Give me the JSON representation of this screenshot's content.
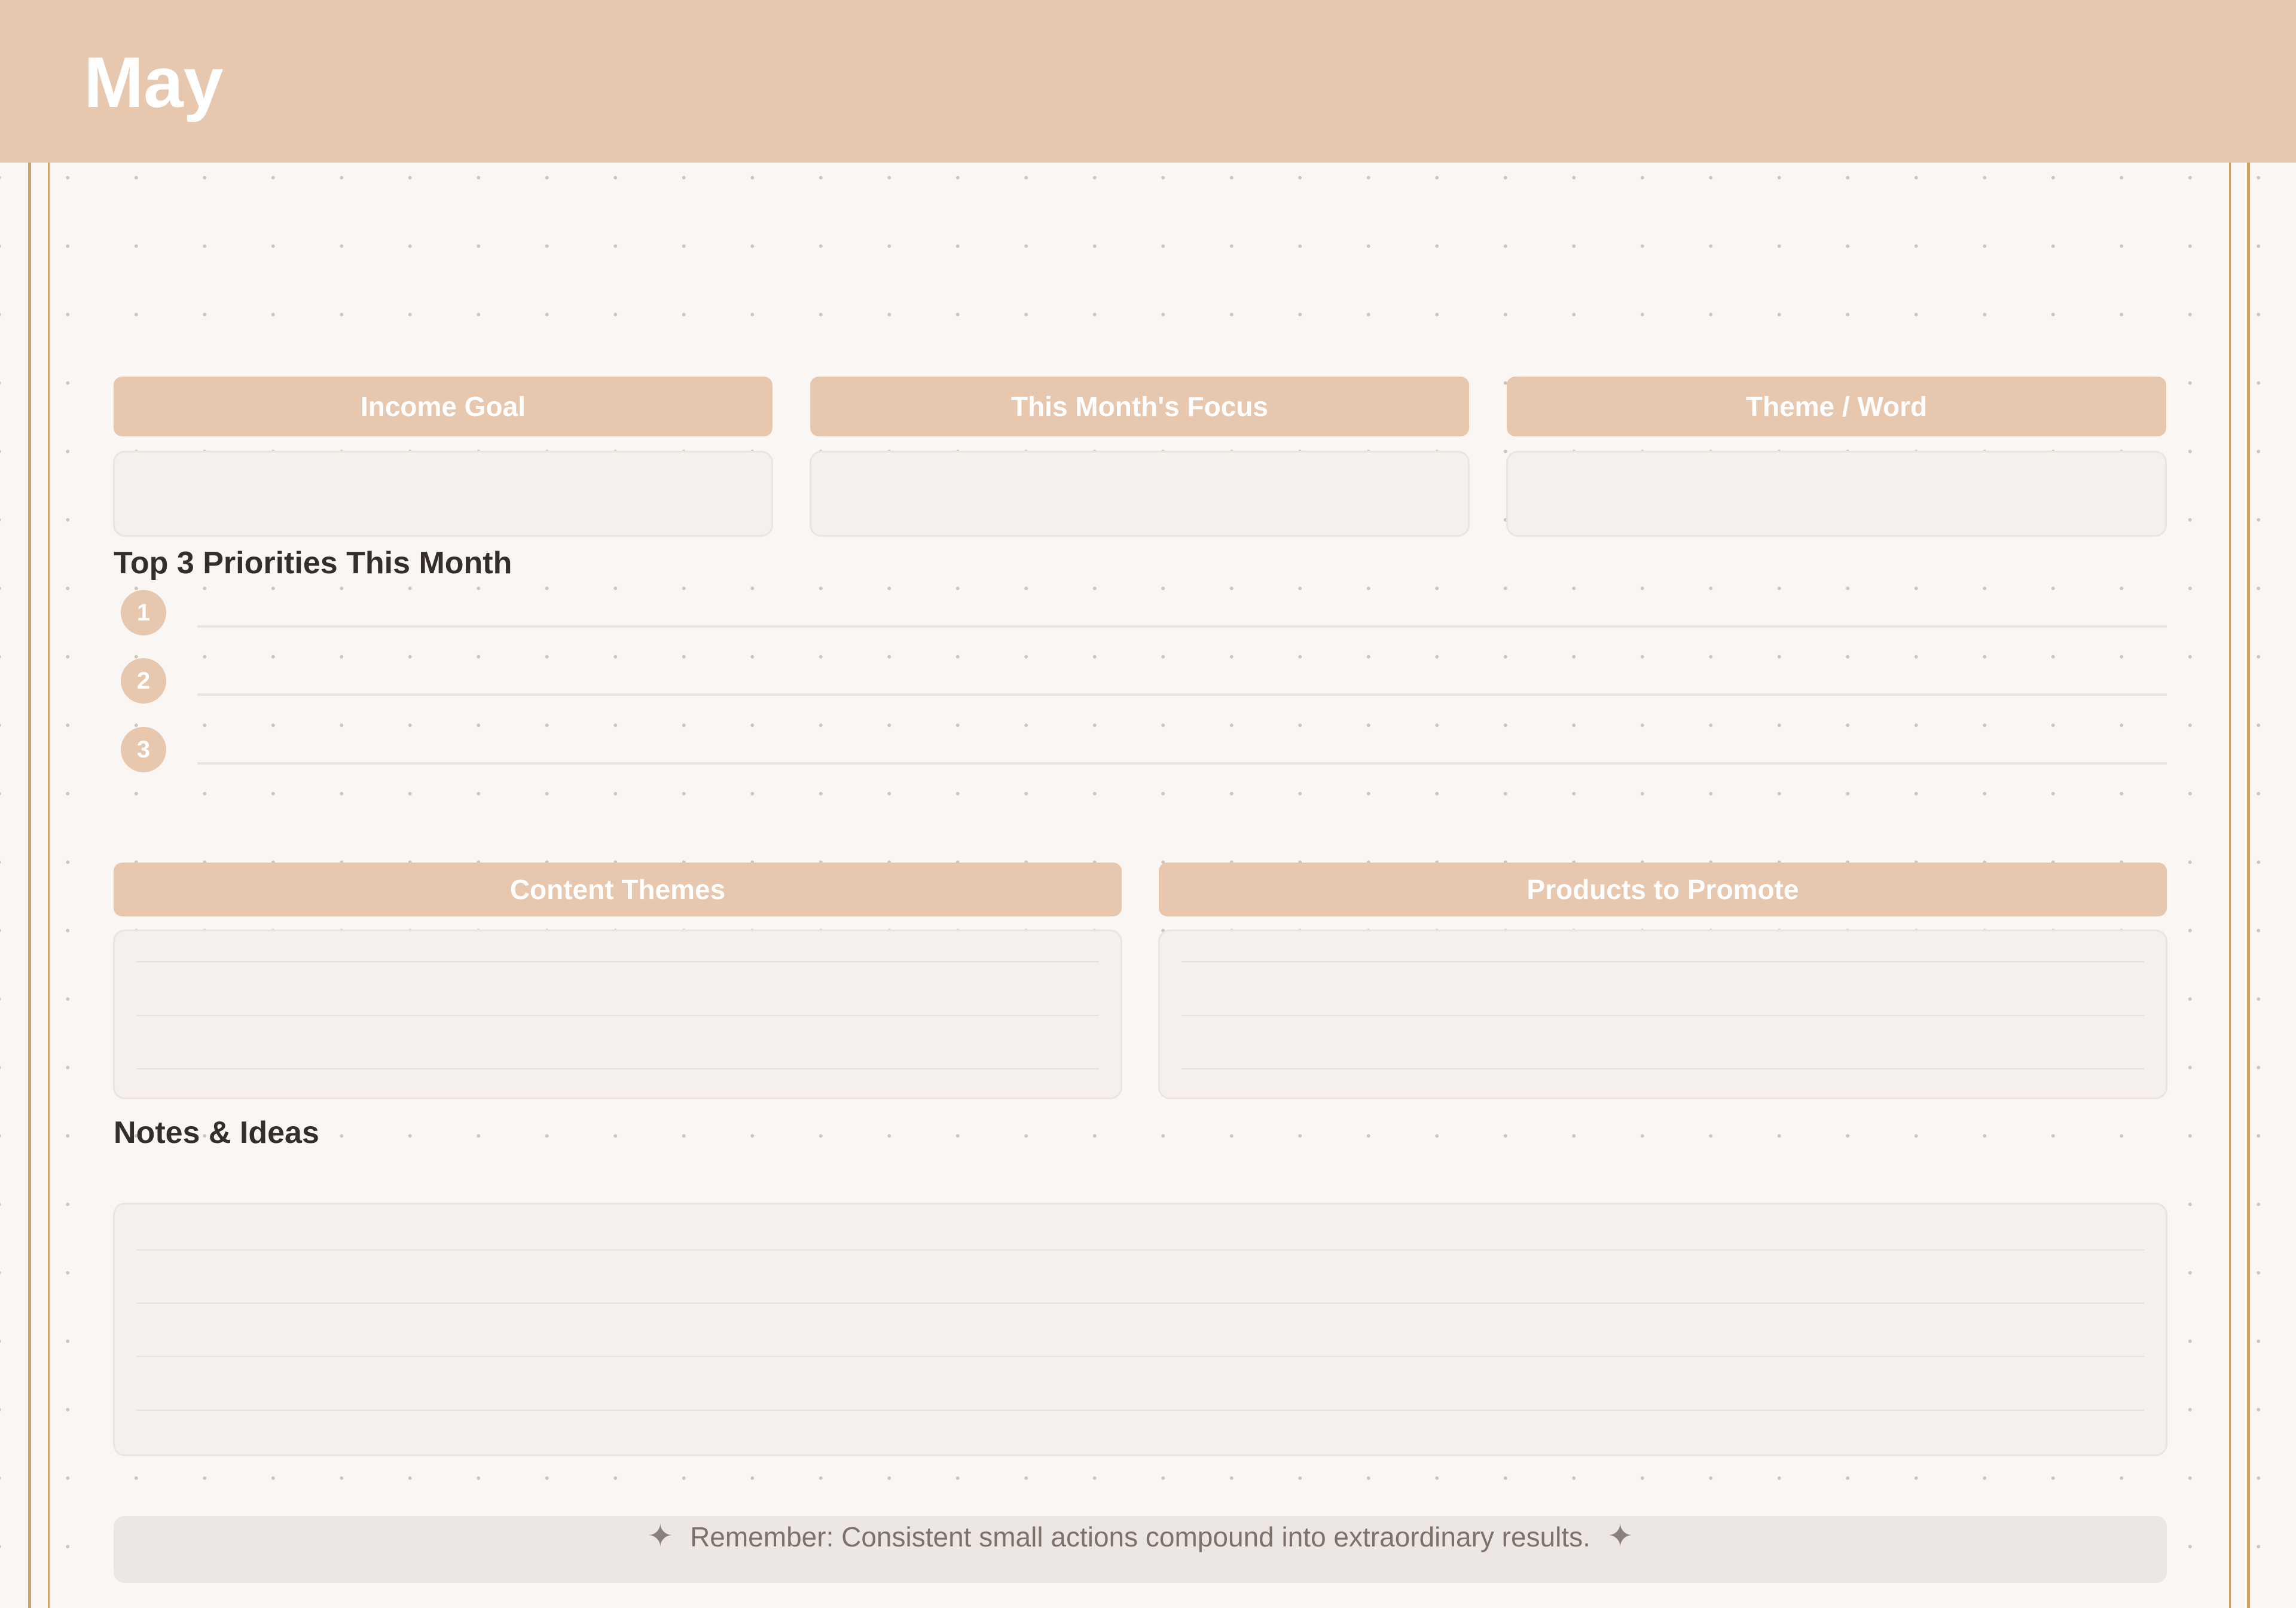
{
  "header": {
    "title": "May"
  },
  "cards": [
    {
      "label": "Income Goal"
    },
    {
      "label": "This Month's Focus"
    },
    {
      "label": "Theme / Word"
    }
  ],
  "priorities": {
    "title": "Top 3 Priorities This Month",
    "items": [
      "1",
      "2",
      "3"
    ]
  },
  "panels": [
    {
      "label": "Content Themes"
    },
    {
      "label": "Products to Promote"
    }
  ],
  "notes": {
    "title": "Notes & Ideas"
  },
  "quote": {
    "text": "Remember: Consistent small actions compound into extraordinary results.",
    "icon": "sparkle-icon"
  },
  "colors": {
    "accent": "#e8c7af",
    "background": "#faf6f3",
    "border_gold": "#c9a36a",
    "field": "#f5f0eb"
  }
}
